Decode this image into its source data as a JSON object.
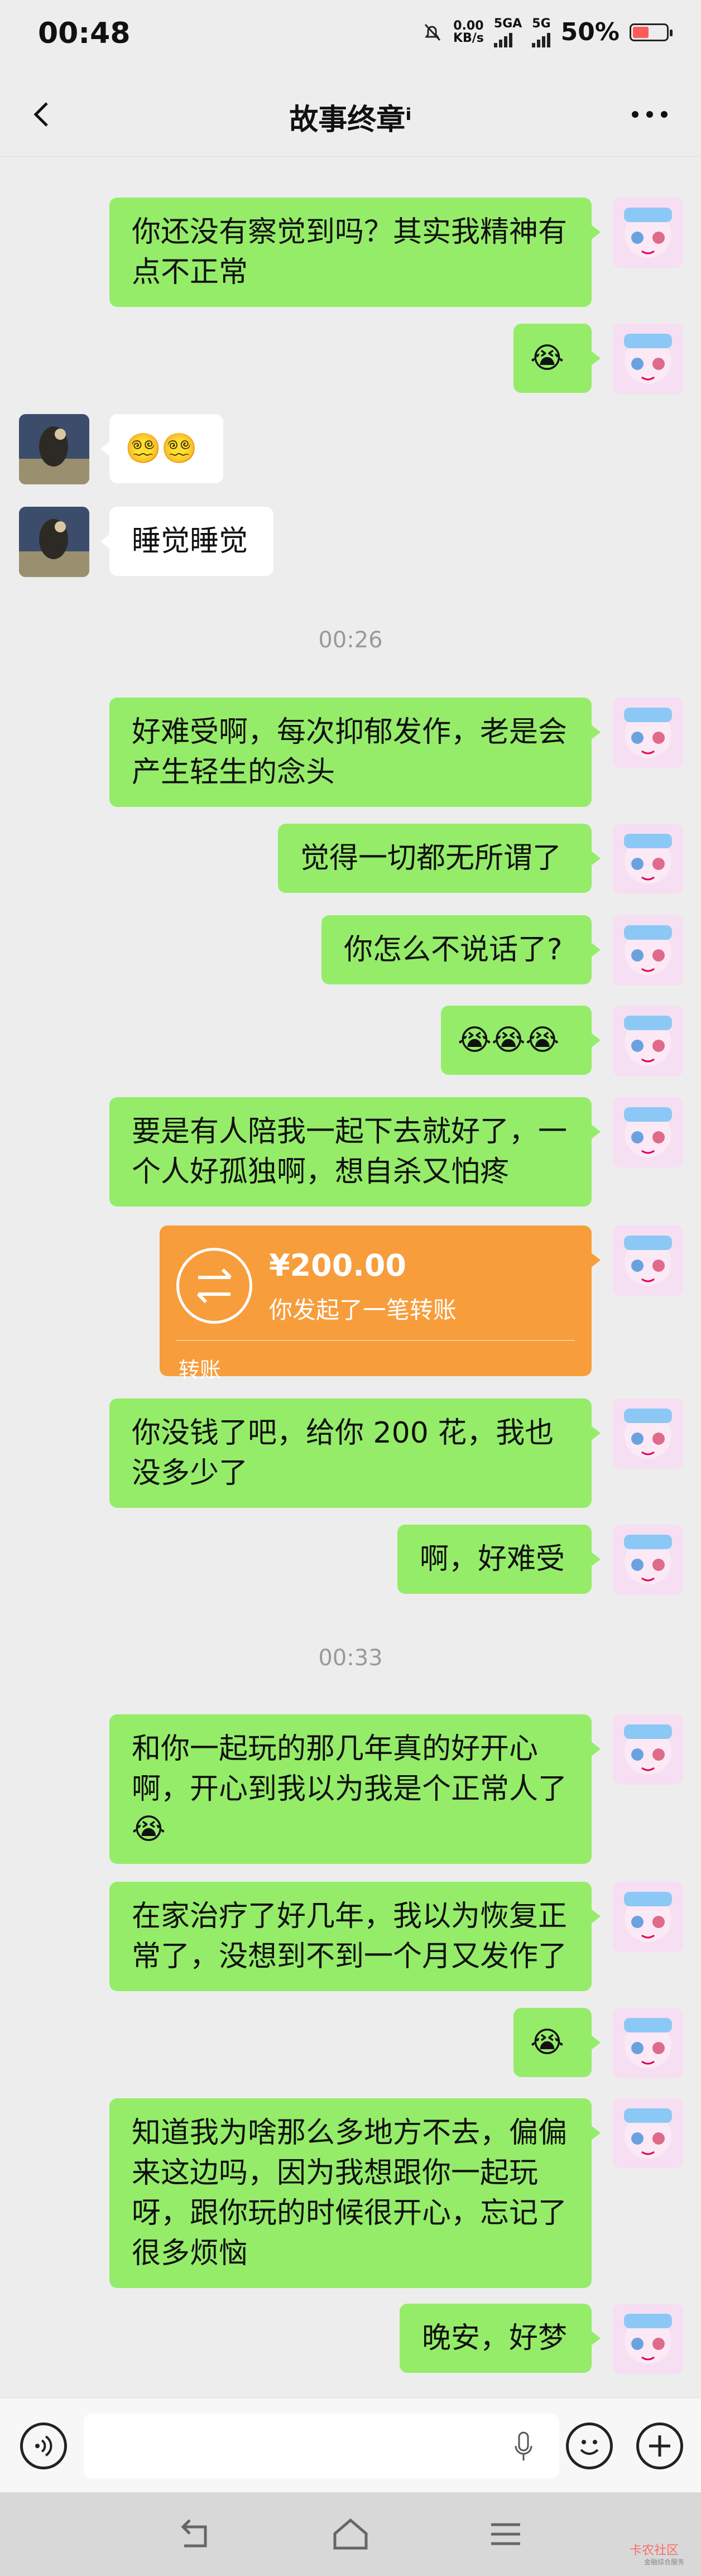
{
  "status_bar": {
    "time": "00:48",
    "net_speed_top": "0.00",
    "net_speed_bottom": "KB/s",
    "net_1": "5GA",
    "net_2": "5G",
    "battery": "50%"
  },
  "header": {
    "title": "故事终章ⁱ"
  },
  "messages": [
    {
      "text": "你还没有察觉到吗？其实我精神有点不正常"
    },
    {
      "text": "😭"
    },
    {
      "text": "😵‍💫😵‍💫"
    },
    {
      "text": "睡觉睡觉"
    },
    {
      "text": "00:26"
    },
    {
      "text": "好难受啊，每次抑郁发作，老是会产生轻生的念头"
    },
    {
      "text": "觉得一切都无所谓了"
    },
    {
      "text": "你怎么不说话了?"
    },
    {
      "text": "😭😭😭"
    },
    {
      "text": "要是有人陪我一起下去就好了，一个人好孤独啊，想自杀又怕疼"
    },
    {
      "text": "你没钱了吧，给你 200 花，我也没多少了"
    },
    {
      "text": "啊，好难受"
    },
    {
      "text": "00:33"
    },
    {
      "text": "和你一起玩的那几年真的好开心啊，开心到我以为我是个正常人了😭"
    },
    {
      "text": "在家治疗了好几年，我以为恢复正常了，没想到不到一个月又发作了"
    },
    {
      "text": "😭"
    },
    {
      "text": "知道我为啥那么多地方不去，偏偏来这边吗，因为我想跟你一起玩呀，跟你玩的时候很开心，忘记了很多烦恼"
    },
    {
      "text": "晚安，好梦"
    }
  ],
  "transfer": {
    "amount": "¥200.00",
    "desc": "你发起了一笔转账",
    "label": "转账"
  },
  "input": {
    "placeholder": ""
  },
  "watermark": {
    "text": "卡农社区",
    "sub": "金融综合服务"
  }
}
